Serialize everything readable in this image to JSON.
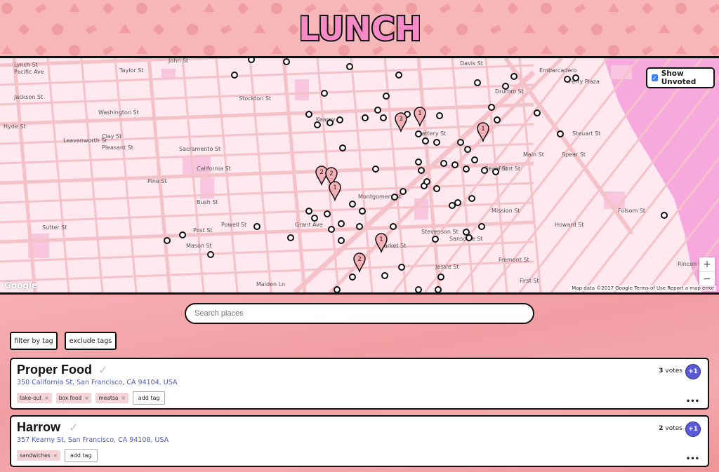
{
  "header": {
    "logo_text": "LUNCH"
  },
  "map": {
    "show_unvoted_label": "Show Unvoted",
    "zoom_in": "+",
    "zoom_out": "−",
    "google_label": "Google",
    "attribution": "Map data ©2017 Google   Terms of Use   Report a map error",
    "streets": [
      "Lynch St",
      "Pacific Ave",
      "John St",
      "Jackson St",
      "Taylor St",
      "Washington St",
      "Clay St",
      "Sacramento St",
      "Pleasant St",
      "California St",
      "Pine St",
      "Bush St",
      "Sutter St",
      "Post St",
      "Hyde St",
      "Leavenworth St",
      "Mason St",
      "Powell St",
      "Stockton St",
      "Kearny St",
      "Grant Ave",
      "Montgomery St",
      "Battery St",
      "Sansome St",
      "Davis St",
      "Drumm St",
      "Front St",
      "Main St",
      "Beale St",
      "Fremont St",
      "First St",
      "Market St",
      "Stevenson St",
      "Jessie St",
      "Mission St",
      "Howard St",
      "Folsom St",
      "Spear St",
      "Steuart St",
      "Maiden Ln",
      "Embarcadero",
      "Ferry Plaza",
      "Rincon Hill"
    ],
    "pin_labels": [
      "1",
      "1",
      "3",
      "1",
      "2",
      "2",
      "1",
      "2"
    ]
  },
  "search": {
    "placeholder": "Search places"
  },
  "filters": {
    "filter_by_tag": "filter by tag",
    "exclude_tags": "exclude tags"
  },
  "restaurants": [
    {
      "name": "Proper Food",
      "address": "350 California St, San Francisco, CA 94104, USA",
      "tags": [
        "take-out",
        "box food",
        "meatsa"
      ],
      "votes": "3",
      "votes_label": "votes"
    },
    {
      "name": "Harrow",
      "address": "357 Kearny St, San Francisco, CA 94108, USA",
      "tags": [
        "sandwiches"
      ],
      "votes": "2",
      "votes_label": "votes"
    }
  ],
  "labels": {
    "add_tag": "add tag",
    "plus_one": "+1",
    "more": "•••",
    "tag_remove": "×",
    "check": "✓"
  },
  "colors": {
    "accent": "#5b5bd6",
    "map_bg": "#fde9ef",
    "road": "#f5c2c9",
    "water": "#f7a9dd",
    "pin": "#f4b1b8"
  }
}
